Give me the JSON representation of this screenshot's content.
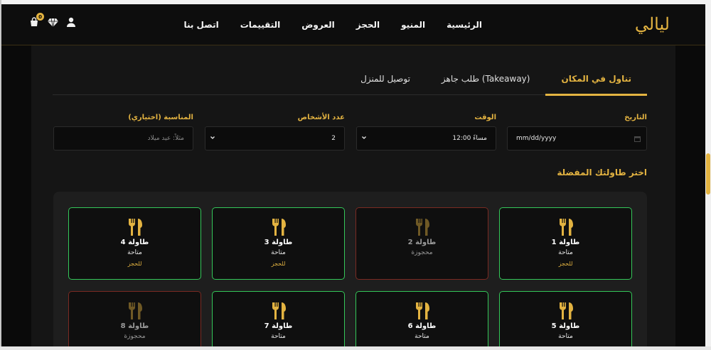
{
  "header": {
    "logo": "ليالي",
    "nav": [
      "الرئيسية",
      "المنيو",
      "الحجز",
      "العروض",
      "التقييمات",
      "اتصل بنا"
    ],
    "cart_count": "0"
  },
  "tabs": [
    {
      "label": "تناول في المكان",
      "active": true
    },
    {
      "label": "طلب جاهز (Takeaway)",
      "active": false
    },
    {
      "label": "توصيل للمنزل",
      "active": false
    }
  ],
  "form": {
    "date": {
      "label": "التاريخ",
      "value": "mm/dd/yyyy"
    },
    "time": {
      "label": "الوقت",
      "value": "12:00 مساءً"
    },
    "guests": {
      "label": "عدد الأشخاص",
      "value": "2"
    },
    "occasion": {
      "label": "المناسبة (اختياري)",
      "placeholder": "مثلاً: عيد ميلاد"
    }
  },
  "section_title": "اختر طاولتك المفضلة",
  "tables": [
    {
      "name": "طاولة 1",
      "status": "متاحة",
      "action": "للحجز",
      "available": true
    },
    {
      "name": "طاولة 2",
      "status": "محجوزة",
      "action": "",
      "available": false
    },
    {
      "name": "طاولة 3",
      "status": "متاحة",
      "action": "للحجز",
      "available": true
    },
    {
      "name": "طاولة 4",
      "status": "متاحة",
      "action": "للحجز",
      "available": true
    },
    {
      "name": "طاولة 5",
      "status": "متاحة",
      "action": "",
      "available": true
    },
    {
      "name": "طاولة 6",
      "status": "متاحة",
      "action": "",
      "available": true
    },
    {
      "name": "طاولة 7",
      "status": "متاحة",
      "action": "",
      "available": true
    },
    {
      "name": "طاولة 8",
      "status": "محجوزة",
      "action": "",
      "available": false
    }
  ],
  "colors": {
    "accent": "#e3b341",
    "available_border": "#34c759",
    "reserved_border": "#7a2a22",
    "background": "#0a0a0a"
  }
}
